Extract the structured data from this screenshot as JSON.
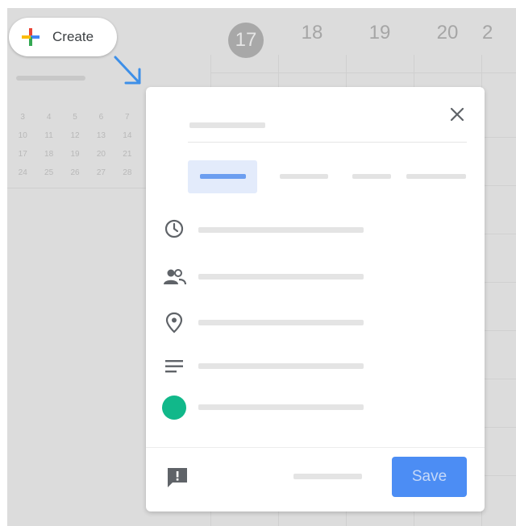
{
  "create_button": {
    "label": "Create",
    "icon": "plus-multicolor-icon",
    "colors": [
      "#ea4335",
      "#4285f4",
      "#fbbc05",
      "#34a853"
    ]
  },
  "calendar": {
    "today": "17",
    "day_numbers": [
      "18",
      "19",
      "20",
      "2"
    ],
    "mini_calendar_rows": [
      [
        "3",
        "4",
        "5",
        "6",
        "7"
      ],
      [
        "10",
        "11",
        "12",
        "13",
        "14"
      ],
      [
        "17",
        "18",
        "19",
        "20",
        "21"
      ],
      [
        "24",
        "25",
        "26",
        "27",
        "28"
      ]
    ]
  },
  "dialog": {
    "close_icon": "close-icon",
    "row_icons": [
      "clock-icon",
      "people-icon",
      "location-pin-icon",
      "description-lines-icon"
    ],
    "event_color": "#11b88a",
    "accent_color": "#4c8df4",
    "feedback_icon": "feedback-icon",
    "save_label": "Save"
  },
  "annotation": {
    "icon": "arrow-down-right-icon",
    "color": "#3d8fe8"
  }
}
